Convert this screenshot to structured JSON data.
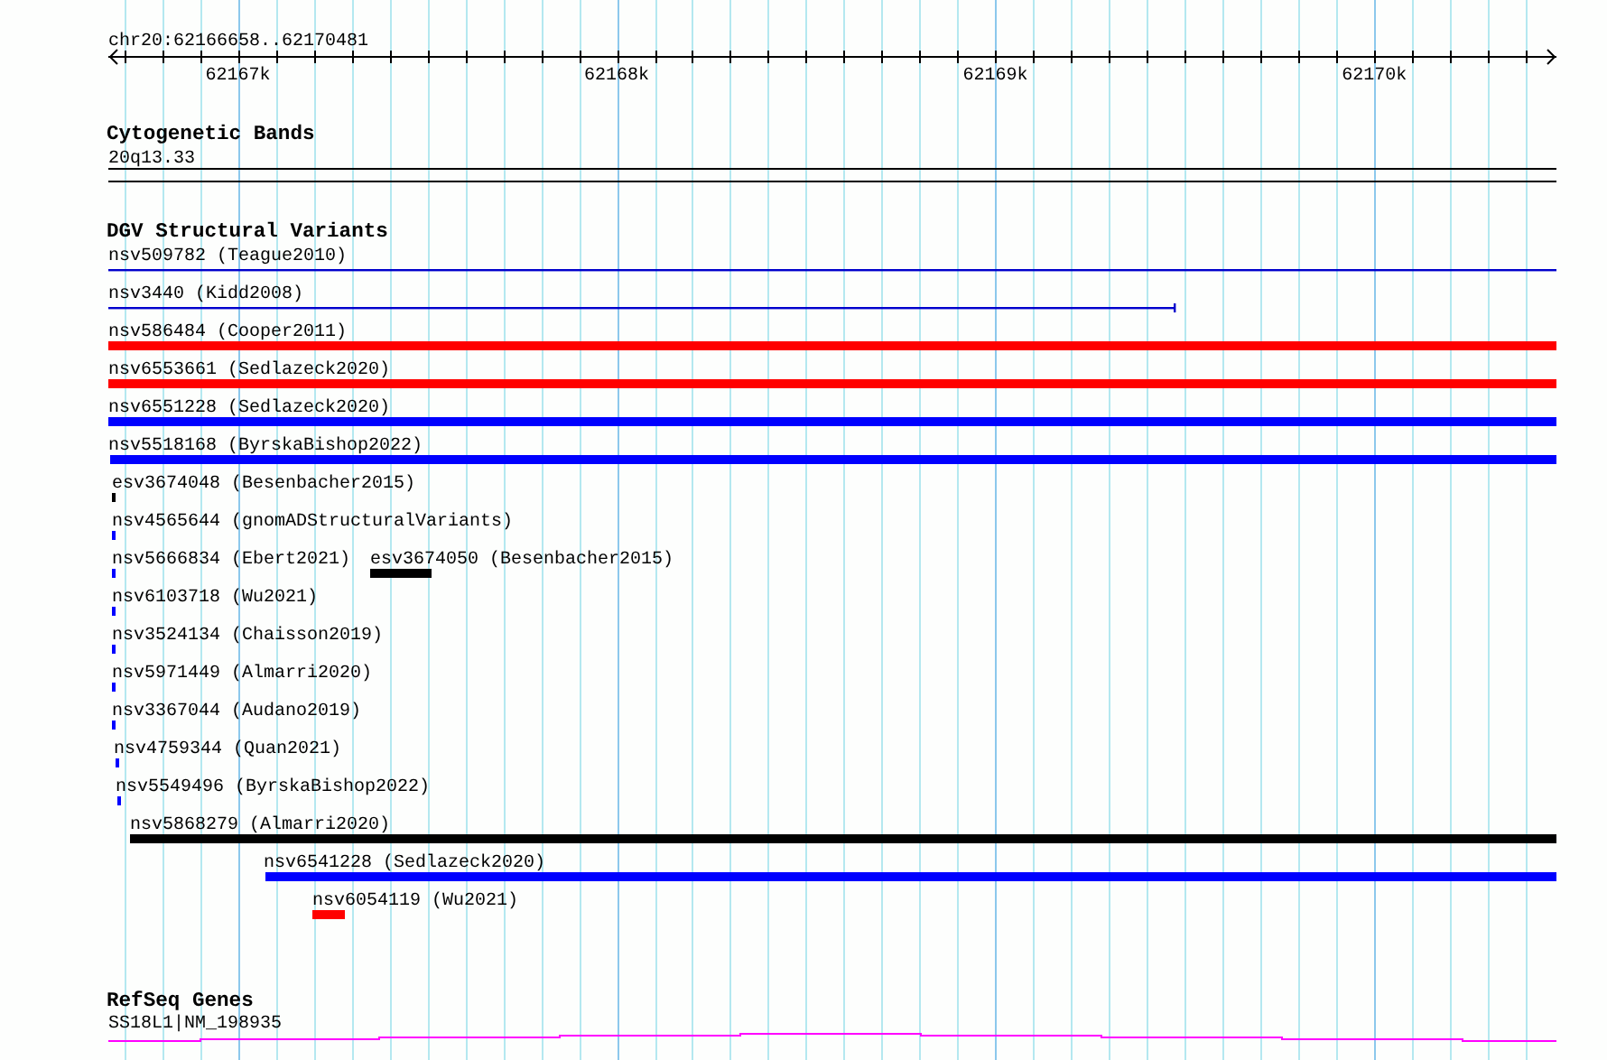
{
  "location": "chr20:62166658..62170481",
  "ruler": {
    "tick_labels": [
      "62167k",
      "62168k",
      "62169k",
      "62170k"
    ]
  },
  "tracks": [
    {
      "kind": "bands",
      "title": "Cytogenetic Bands",
      "features": [
        {
          "label": "20q13.33"
        }
      ]
    },
    {
      "kind": "variants",
      "title": "DGV Structural Variants",
      "features": [
        {
          "label": "nsv509782 (Teague2010)",
          "kind": "line",
          "color": "#0000cc"
        },
        {
          "label": "nsv3440 (Kidd2008)",
          "kind": "line",
          "color": "#0000cc"
        },
        {
          "label": "nsv586484 (Cooper2011)",
          "kind": "bar",
          "color": "#ff0000"
        },
        {
          "label": "nsv6553661 (Sedlazeck2020)",
          "kind": "bar",
          "color": "#ff0000"
        },
        {
          "label": "nsv6551228 (Sedlazeck2020)",
          "kind": "bar",
          "color": "#0000ff"
        },
        {
          "label": "nsv5518168 (ByrskaBishop2022)",
          "kind": "bar",
          "color": "#0000ff"
        },
        {
          "label": "esv3674048 (Besenbacher2015)",
          "kind": "bar",
          "color": "#000000"
        },
        {
          "label": "nsv4565644 (gnomADStructuralVariants)",
          "kind": "bar",
          "color": "#0000ff"
        },
        {
          "label": "nsv5666834 (Ebert2021)",
          "kind": "bar",
          "color": "#0000ff"
        },
        {
          "label": "esv3674050 (Besenbacher2015)",
          "kind": "bar",
          "color": "#000000"
        },
        {
          "label": "nsv6103718 (Wu2021)",
          "kind": "bar",
          "color": "#0000ff"
        },
        {
          "label": "nsv3524134 (Chaisson2019)",
          "kind": "bar",
          "color": "#0000ff"
        },
        {
          "label": "nsv5971449 (Almarri2020)",
          "kind": "bar",
          "color": "#0000ff"
        },
        {
          "label": "nsv3367044 (Audano2019)",
          "kind": "bar",
          "color": "#0000ff"
        },
        {
          "label": "nsv4759344 (Quan2021)",
          "kind": "bar",
          "color": "#0000ff"
        },
        {
          "label": "nsv5549496 (ByrskaBishop2022)",
          "kind": "bar",
          "color": "#0000ff"
        },
        {
          "label": "nsv5868279 (Almarri2020)",
          "kind": "bar",
          "color": "#000000"
        },
        {
          "label": "nsv6541228 (Sedlazeck2020)",
          "kind": "bar",
          "color": "#0000ff"
        },
        {
          "label": "nsv6054119 (Wu2021)",
          "kind": "bar",
          "color": "#ff0000"
        }
      ]
    },
    {
      "kind": "genes",
      "title": "RefSeq Genes",
      "features": [
        {
          "label": "SS18L1|NM_198935"
        }
      ]
    }
  ]
}
